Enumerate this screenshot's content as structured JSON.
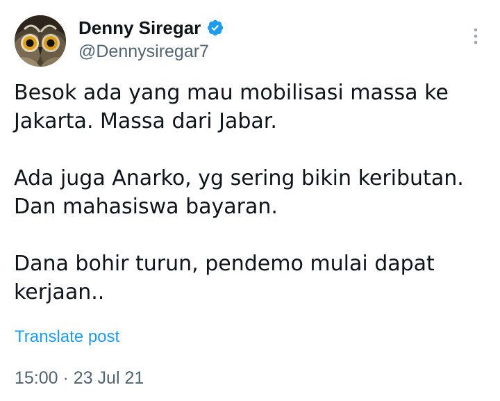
{
  "author": {
    "display_name": "Denny Siregar",
    "handle": "@Dennysiregar7",
    "avatar_icon": "owl-avatar",
    "verified_icon": "verified-badge-icon",
    "verified_color": "#1d9bf0"
  },
  "post": {
    "paragraphs": [
      [
        "Besok ada yang mau mobilisasi massa ke",
        "Jakarta. Massa dari Jabar."
      ],
      [
        "Ada juga Anarko, yg sering bikin keributan.",
        "Dan mahasiswa bayaran."
      ],
      [
        "Dana bohir turun, pendemo mulai dapat",
        "kerjaan.."
      ]
    ],
    "translate_label": "Translate post",
    "time": "15:00",
    "separator": "·",
    "date": "23 Jul 21"
  },
  "menu": {
    "icon": "more-options-icon"
  },
  "colors": {
    "text": "#0f1419",
    "secondary": "#536471",
    "accent": "#1d9bf0"
  }
}
